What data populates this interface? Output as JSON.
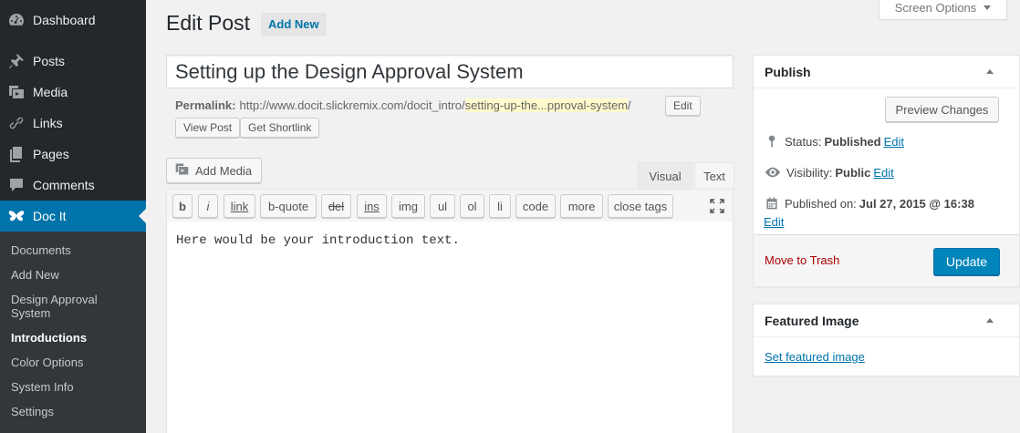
{
  "sidebar": {
    "items": [
      {
        "label": "Dashboard",
        "icon": "dashboard-icon"
      },
      {
        "label": "Posts",
        "icon": "pin-icon"
      },
      {
        "label": "Media",
        "icon": "media-icon"
      },
      {
        "label": "Links",
        "icon": "link-icon"
      },
      {
        "label": "Pages",
        "icon": "pages-icon"
      },
      {
        "label": "Comments",
        "icon": "comment-icon"
      },
      {
        "label": "Doc It",
        "icon": "butterfly-icon"
      }
    ],
    "submenu": [
      "Documents",
      "Add New",
      "Design Approval System",
      "Introductions",
      "Color Options",
      "System Info",
      "Settings"
    ]
  },
  "header": {
    "title": "Edit Post",
    "add_new": "Add New",
    "screen_options": "Screen Options"
  },
  "post": {
    "title": "Setting up the Design Approval System",
    "permalink_label": "Permalink:",
    "permalink_base": "http://www.docit.slickremix.com/docit_intro/",
    "permalink_slug": "setting-up-the...pproval-system",
    "permalink_end": "/",
    "edit_btn": "Edit",
    "view_post": "View Post",
    "get_shortlink": "Get Shortlink"
  },
  "editor": {
    "add_media": "Add Media",
    "tab_visual": "Visual",
    "tab_text": "Text",
    "quicktags": [
      "b",
      "i",
      "link",
      "b-quote",
      "del",
      "ins",
      "img",
      "ul",
      "ol",
      "li",
      "code",
      "more",
      "close tags"
    ],
    "content": "Here would be your introduction text."
  },
  "publish": {
    "heading": "Publish",
    "preview": "Preview Changes",
    "status_label": "Status:",
    "status_value": "Published",
    "visibility_label": "Visibility:",
    "visibility_value": "Public",
    "published_label": "Published on:",
    "published_value": "Jul 27, 2015 @ 16:38",
    "edit": "Edit",
    "trash": "Move to Trash",
    "update": "Update"
  },
  "featured": {
    "heading": "Featured Image",
    "set_link": "Set featured image"
  },
  "colors": {
    "sidebar_bg": "#23282d",
    "active_menu": "#0073aa",
    "link": "#0073aa",
    "primary_button": "#0085ba",
    "trash": "#a00"
  }
}
